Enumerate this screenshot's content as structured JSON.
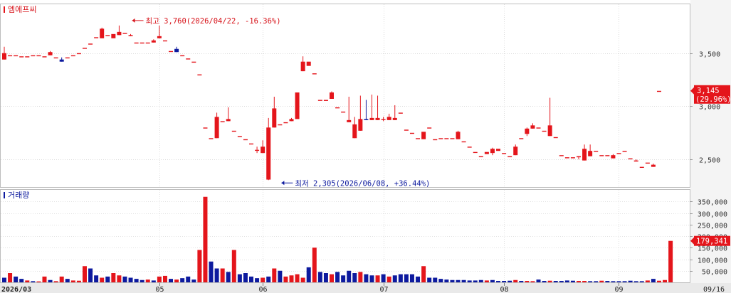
{
  "chart_data": [
    {
      "type": "candlestick",
      "title": "엠에프씨",
      "y_ticks": [
        2500,
        3000,
        3500
      ],
      "y_tick_labels": [
        "2,500",
        "3,000",
        "3,500"
      ],
      "ylim": [
        2240,
        3960
      ],
      "last_price": {
        "label": "3,145",
        "change": "(29.96%)",
        "value": 3145,
        "color": "#e4151b"
      },
      "annotations": [
        {
          "text": "최고 3,760(2026/04/22, -16.36%)",
          "index": 22,
          "value": 3760,
          "color": "#d7131a"
        },
        {
          "text": "최저 2,305(2026/06/08, +36.44%)",
          "index": 48,
          "value": 2305,
          "color": "#0d1a9e"
        }
      ],
      "x_tick_labels": [
        {
          "label": "2026/03",
          "index": 0
        },
        {
          "label": "05",
          "index": 27
        },
        {
          "label": "06",
          "index": 45
        },
        {
          "label": "07",
          "index": 66
        },
        {
          "label": "08",
          "index": 87
        },
        {
          "label": "09",
          "index": 107
        },
        {
          "label": "09/16",
          "index": 117
        }
      ],
      "colors": {
        "up": "#e4151b",
        "down": "#0d1a9e"
      },
      "ohlc": [
        [
          3440,
          3560,
          3440,
          3500
        ],
        [
          3480,
          3480,
          3480,
          3480
        ],
        [
          3480,
          3480,
          3480,
          3480
        ],
        [
          3470,
          3470,
          3470,
          3470
        ],
        [
          3470,
          3470,
          3470,
          3470
        ],
        [
          3480,
          3480,
          3480,
          3480
        ],
        [
          3480,
          3480,
          3480,
          3480
        ],
        [
          3470,
          3470,
          3470,
          3470
        ],
        [
          3480,
          3520,
          3480,
          3510
        ],
        [
          3460,
          3460,
          3460,
          3460
        ],
        [
          3440,
          3460,
          3420,
          3420
        ],
        [
          3460,
          3460,
          3460,
          3460
        ],
        [
          3480,
          3480,
          3480,
          3480
        ],
        [
          3500,
          3500,
          3500,
          3500
        ],
        [
          3550,
          3550,
          3550,
          3550
        ],
        [
          3590,
          3590,
          3590,
          3590
        ],
        [
          3650,
          3650,
          3650,
          3650
        ],
        [
          3640,
          3740,
          3640,
          3730
        ],
        [
          3670,
          3670,
          3670,
          3670
        ],
        [
          3640,
          3680,
          3640,
          3680
        ],
        [
          3670,
          3760,
          3670,
          3700
        ],
        [
          3690,
          3690,
          3690,
          3690
        ],
        [
          3660,
          3680,
          3660,
          3670
        ],
        [
          3600,
          3600,
          3600,
          3600
        ],
        [
          3600,
          3600,
          3600,
          3600
        ],
        [
          3600,
          3600,
          3600,
          3600
        ],
        [
          3600,
          3630,
          3600,
          3620
        ],
        [
          3640,
          3760,
          3640,
          3660
        ],
        [
          3620,
          3620,
          3620,
          3620
        ],
        [
          3520,
          3520,
          3520,
          3520
        ],
        [
          3540,
          3560,
          3510,
          3510
        ],
        [
          3480,
          3480,
          3480,
          3480
        ],
        [
          3450,
          3450,
          3450,
          3450
        ],
        [
          3420,
          3420,
          3420,
          3420
        ],
        [
          3300,
          3300,
          3300,
          3300
        ],
        [
          2800,
          2800,
          2800,
          2800
        ],
        [
          2700,
          2700,
          2700,
          2700
        ],
        [
          2700,
          2940,
          2700,
          2900
        ],
        [
          2860,
          2860,
          2860,
          2860
        ],
        [
          2860,
          2990,
          2860,
          2880
        ],
        [
          2770,
          2770,
          2770,
          2770
        ],
        [
          2720,
          2720,
          2720,
          2720
        ],
        [
          2690,
          2690,
          2690,
          2690
        ],
        [
          2650,
          2650,
          2650,
          2650
        ],
        [
          2590,
          2620,
          2560,
          2590
        ],
        [
          2560,
          2680,
          2560,
          2620
        ],
        [
          2310,
          2890,
          2305,
          2800
        ],
        [
          2800,
          3090,
          2800,
          2980
        ],
        [
          2830,
          2830,
          2830,
          2830
        ],
        [
          2850,
          2850,
          2850,
          2850
        ],
        [
          2860,
          2890,
          2860,
          2880
        ],
        [
          2880,
          3100,
          2880,
          3130
        ],
        [
          3330,
          3470,
          3330,
          3420
        ],
        [
          3380,
          3420,
          3380,
          3420
        ],
        [
          3310,
          3310,
          3310,
          3310
        ],
        [
          3060,
          3060,
          3060,
          3060
        ],
        [
          3050,
          3050,
          3050,
          3060
        ],
        [
          3070,
          3140,
          3070,
          3130
        ],
        [
          2990,
          2990,
          2990,
          2990
        ],
        [
          2950,
          2950,
          2950,
          2950
        ],
        [
          2850,
          3090,
          2850,
          2870
        ],
        [
          2700,
          2900,
          2700,
          2830
        ],
        [
          2770,
          3100,
          2770,
          2880
        ],
        [
          2880,
          3060,
          2870,
          2870
        ],
        [
          2870,
          3110,
          2870,
          2890
        ],
        [
          2870,
          3100,
          2870,
          2890
        ],
        [
          2880,
          2900,
          2860,
          2880
        ],
        [
          2870,
          2930,
          2870,
          2900
        ],
        [
          2870,
          3010,
          2870,
          2890
        ],
        [
          2940,
          2940,
          2940,
          2940
        ],
        [
          2780,
          2780,
          2780,
          2780
        ],
        [
          2750,
          2750,
          2750,
          2750
        ],
        [
          2700,
          2700,
          2700,
          2700
        ],
        [
          2690,
          2750,
          2690,
          2760
        ],
        [
          2800,
          2800,
          2800,
          2800
        ],
        [
          2690,
          2690,
          2690,
          2690
        ],
        [
          2700,
          2700,
          2700,
          2700
        ],
        [
          2700,
          2700,
          2700,
          2700
        ],
        [
          2700,
          2700,
          2700,
          2700
        ],
        [
          2690,
          2770,
          2690,
          2760
        ],
        [
          2670,
          2670,
          2670,
          2670
        ],
        [
          2620,
          2620,
          2620,
          2620
        ],
        [
          2570,
          2570,
          2570,
          2570
        ],
        [
          2530,
          2530,
          2530,
          2530
        ],
        [
          2550,
          2570,
          2550,
          2570
        ],
        [
          2560,
          2610,
          2540,
          2600
        ],
        [
          2580,
          2600,
          2580,
          2600
        ],
        [
          2560,
          2560,
          2560,
          2560
        ],
        [
          2530,
          2530,
          2530,
          2530
        ],
        [
          2540,
          2640,
          2540,
          2620
        ],
        [
          2700,
          2700,
          2700,
          2700
        ],
        [
          2740,
          2800,
          2720,
          2790
        ],
        [
          2790,
          2840,
          2790,
          2820
        ],
        [
          2800,
          2800,
          2800,
          2800
        ],
        [
          2770,
          2770,
          2770,
          2770
        ],
        [
          2720,
          3080,
          2720,
          2820
        ],
        [
          2710,
          2710,
          2710,
          2710
        ],
        [
          2540,
          2540,
          2540,
          2540
        ],
        [
          2520,
          2520,
          2520,
          2520
        ],
        [
          2520,
          2520,
          2520,
          2520
        ],
        [
          2520,
          2530,
          2500,
          2530
        ],
        [
          2490,
          2640,
          2490,
          2600
        ],
        [
          2530,
          2640,
          2530,
          2580
        ],
        [
          2580,
          2580,
          2580,
          2580
        ],
        [
          2540,
          2540,
          2540,
          2540
        ],
        [
          2540,
          2540,
          2540,
          2540
        ],
        [
          2510,
          2550,
          2510,
          2540
        ],
        [
          2560,
          2560,
          2560,
          2560
        ],
        [
          2580,
          2580,
          2580,
          2580
        ],
        [
          2510,
          2510,
          2510,
          2510
        ],
        [
          2480,
          2500,
          2480,
          2490
        ],
        [
          2430,
          2430,
          2430,
          2430
        ],
        [
          2470,
          2470,
          2470,
          2470
        ],
        [
          2430,
          2460,
          2430,
          2450
        ],
        [
          3145,
          3145,
          3145,
          3145
        ]
      ]
    },
    {
      "type": "bar",
      "title": "거래량",
      "y_ticks": [
        50000,
        100000,
        150000,
        200000,
        250000,
        300000,
        350000
      ],
      "y_tick_labels": [
        "50,000",
        "100,000",
        "150,000",
        "200,000",
        "250,000",
        "300,000",
        "350,000"
      ],
      "ylim": [
        0,
        400000
      ],
      "last_value": {
        "label": "179,341",
        "value": 179341,
        "color": "#e4151b"
      },
      "values": [
        20000,
        40000,
        25000,
        15000,
        8000,
        5000,
        4000,
        25000,
        10000,
        5000,
        25000,
        15000,
        8000,
        7000,
        70000,
        60000,
        30000,
        20000,
        25000,
        40000,
        30000,
        25000,
        20000,
        15000,
        10000,
        12000,
        8000,
        25000,
        28000,
        15000,
        12000,
        18000,
        25000,
        12000,
        140000,
        370000,
        90000,
        60000,
        60000,
        45000,
        140000,
        35000,
        40000,
        25000,
        18000,
        20000,
        25000,
        60000,
        50000,
        25000,
        30000,
        35000,
        20000,
        65000,
        150000,
        45000,
        40000,
        35000,
        45000,
        30000,
        50000,
        40000,
        45000,
        35000,
        30000,
        30000,
        35000,
        25000,
        30000,
        35000,
        35000,
        35000,
        25000,
        70000,
        20000,
        20000,
        15000,
        12000,
        10000,
        10000,
        10000,
        8000,
        8000,
        10000,
        8000,
        10000,
        6000,
        6000,
        7000,
        10000,
        6000,
        6000,
        5000,
        12000,
        6000,
        7000,
        6000,
        6000,
        8000,
        7000,
        6000,
        6000,
        5000,
        5000,
        7000,
        6000,
        5000,
        5000,
        5000,
        7000,
        5000,
        5000,
        8000,
        15000,
        7000,
        10000,
        179341
      ],
      "directions": [
        "d",
        "u",
        "d",
        "d",
        "u",
        "d",
        "u",
        "u",
        "d",
        "u",
        "u",
        "d",
        "u",
        "u",
        "u",
        "d",
        "d",
        "u",
        "d",
        "u",
        "u",
        "d",
        "d",
        "d",
        "d",
        "u",
        "d",
        "u",
        "u",
        "d",
        "u",
        "d",
        "d",
        "d",
        "u",
        "u",
        "d",
        "d",
        "u",
        "d",
        "u",
        "d",
        "d",
        "d",
        "d",
        "u",
        "d",
        "u",
        "d",
        "u",
        "u",
        "u",
        "u",
        "d",
        "u",
        "d",
        "d",
        "u",
        "d",
        "d",
        "d",
        "d",
        "u",
        "d",
        "d",
        "u",
        "d",
        "u",
        "d",
        "d",
        "d",
        "d",
        "d",
        "u",
        "d",
        "d",
        "d",
        "d",
        "d",
        "d",
        "d",
        "d",
        "d",
        "d",
        "u",
        "d",
        "d",
        "d",
        "d",
        "u",
        "d",
        "u",
        "u",
        "d",
        "d",
        "u",
        "d",
        "d",
        "d",
        "d",
        "u",
        "u",
        "d",
        "d",
        "u",
        "d",
        "d",
        "d",
        "d",
        "d",
        "d",
        "d",
        "u",
        "d",
        "u",
        "u",
        "u"
      ]
    }
  ]
}
